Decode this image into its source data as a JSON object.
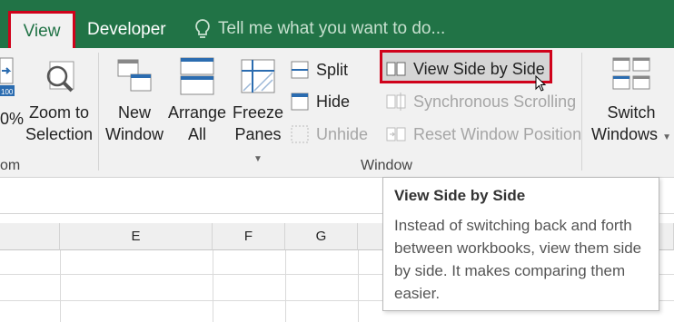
{
  "tabs": {
    "view": "View",
    "developer": "Developer",
    "tell_me": "Tell me what you want to do..."
  },
  "ribbon": {
    "zoom_group": {
      "partial_zoom_label": "0%",
      "zoom_to_selection_line1": "Zoom to",
      "zoom_to_selection_line2": "Selection",
      "group_label_partial": "om",
      "icon_value": "100"
    },
    "window_group": {
      "new_window_line1": "New",
      "new_window_line2": "Window",
      "arrange_all_line1": "Arrange",
      "arrange_all_line2": "All",
      "freeze_panes_line1": "Freeze",
      "freeze_panes_line2": "Panes",
      "split": "Split",
      "hide": "Hide",
      "unhide": "Unhide",
      "view_side_by_side": "View Side by Side",
      "synchronous_scrolling": "Synchronous Scrolling",
      "reset_window_position": "Reset Window Position",
      "group_label": "Window"
    },
    "switch_windows_line1": "Switch",
    "switch_windows_line2": "Windows"
  },
  "columns": [
    "E",
    "F",
    "G"
  ],
  "tooltip": {
    "title": "View Side by Side",
    "body": "Instead of switching back and forth between workbooks, view them side by side. It makes comparing them easier."
  },
  "colors": {
    "ribbon_green": "#217346",
    "highlight_red": "#d0021b"
  }
}
